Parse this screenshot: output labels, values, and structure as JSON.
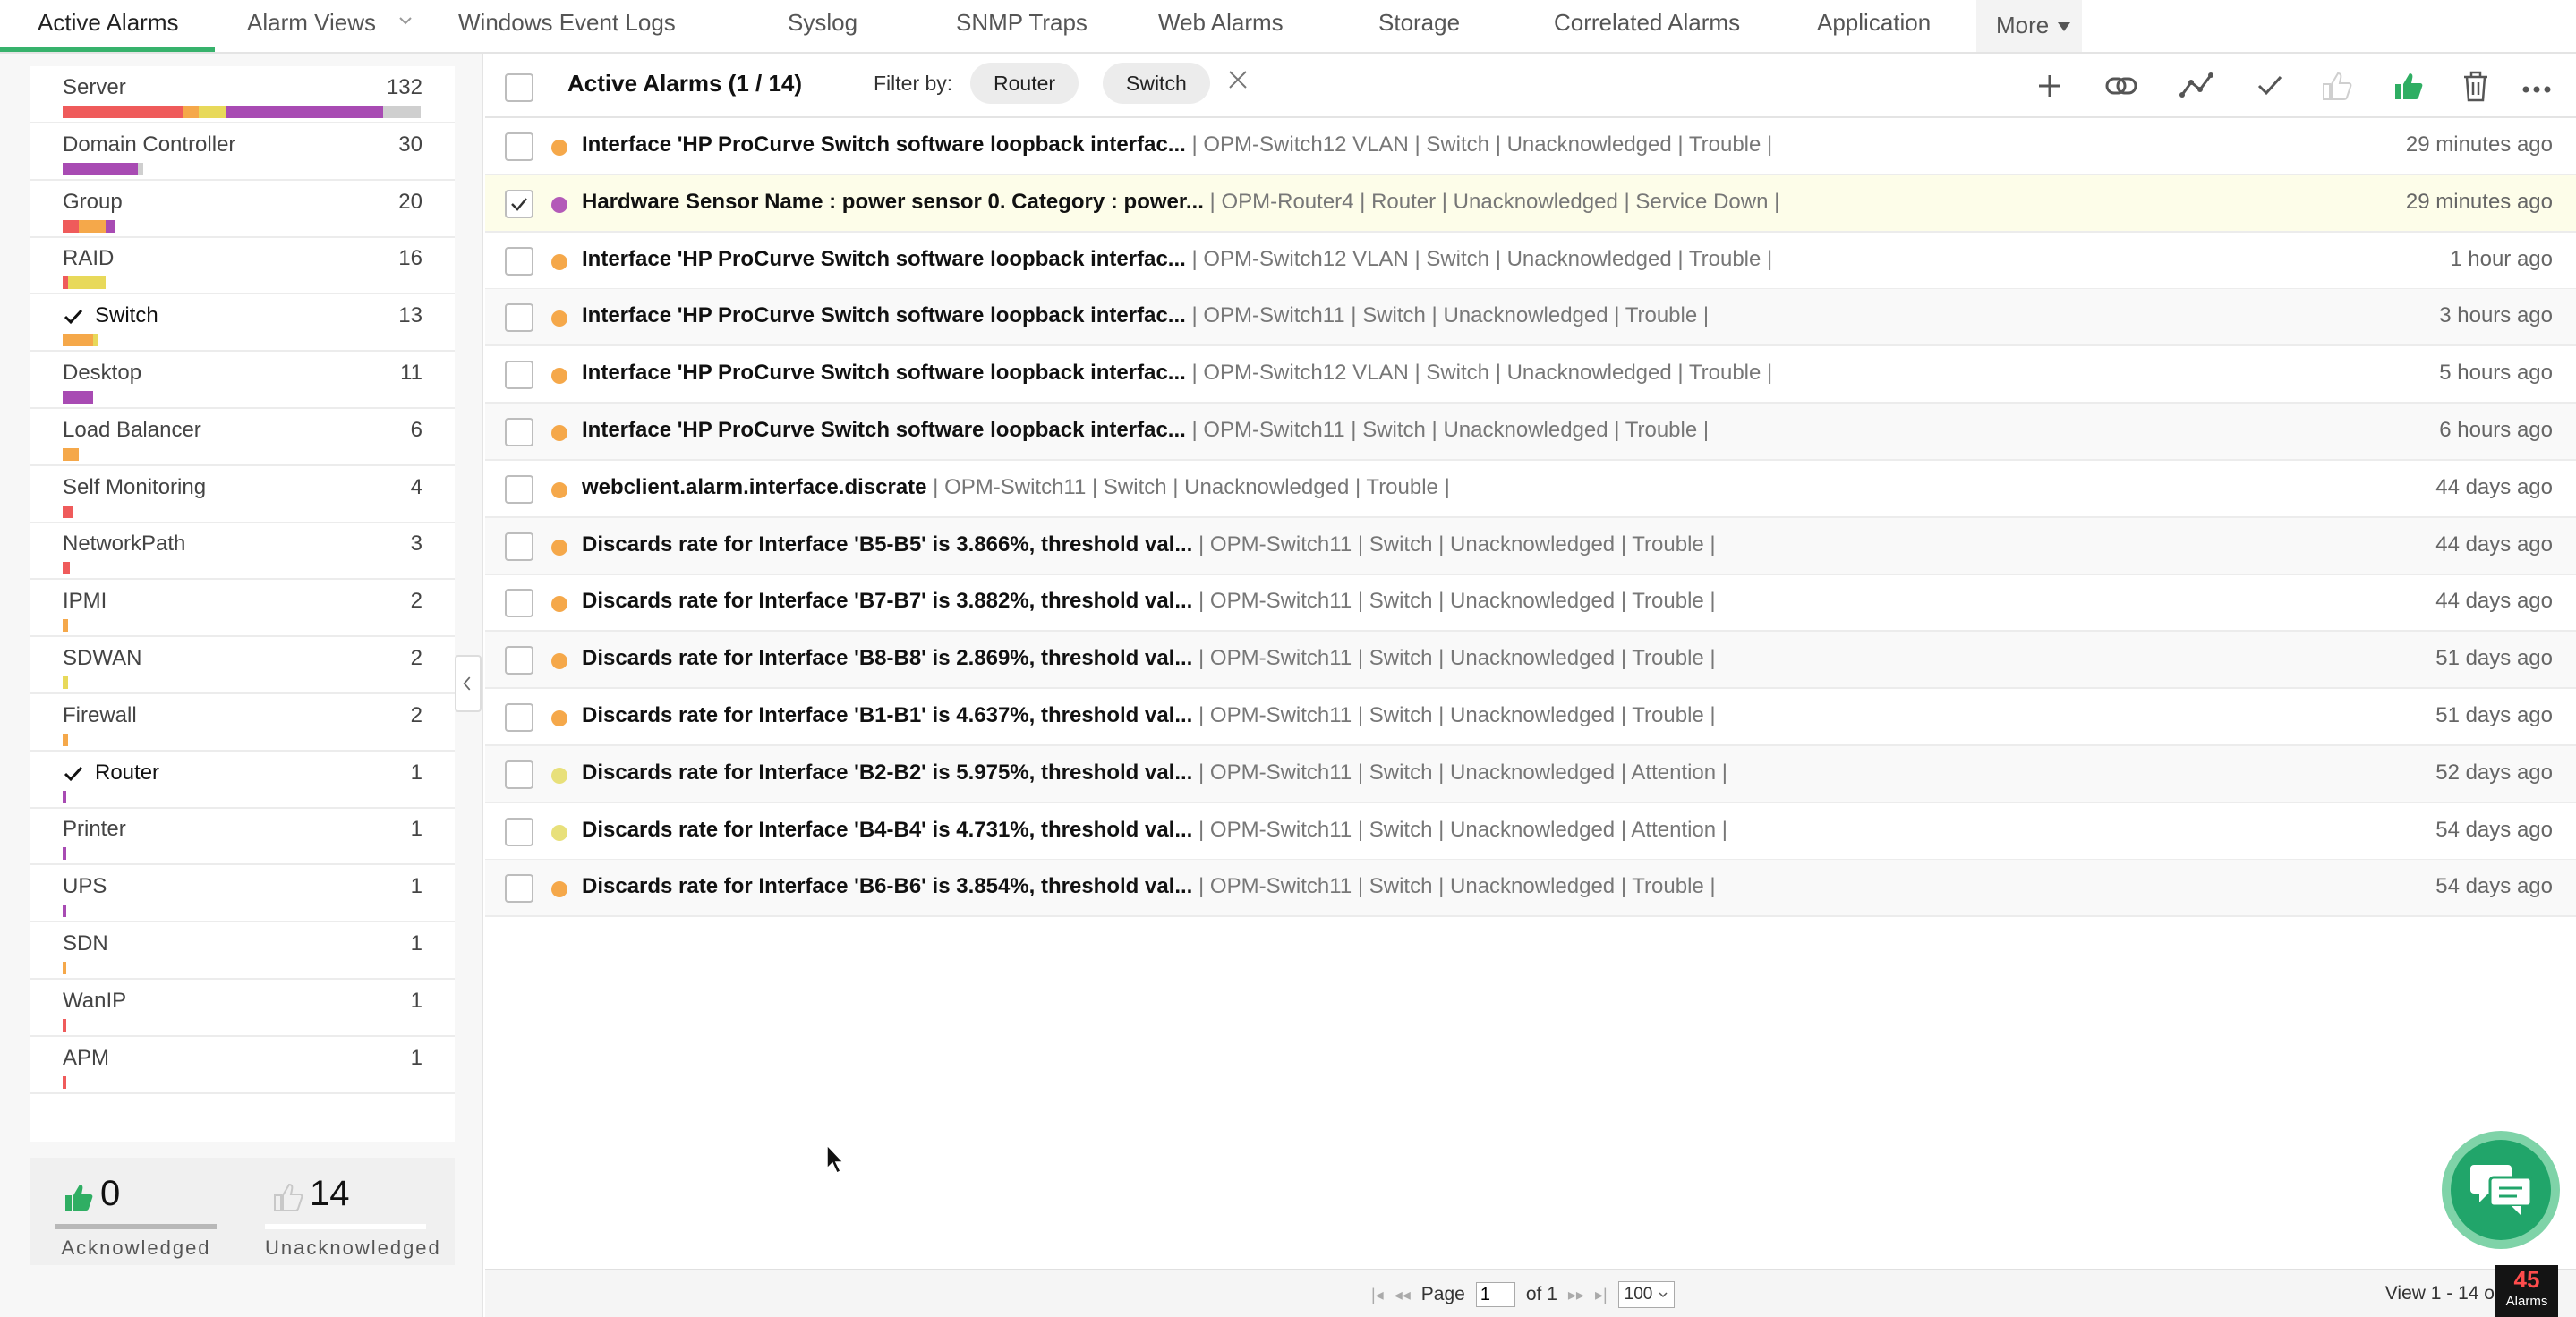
{
  "nav": {
    "tabs": [
      {
        "label": "Active Alarms"
      },
      {
        "label": "Alarm Views"
      },
      {
        "label": "Windows Event Logs"
      },
      {
        "label": "Syslog"
      },
      {
        "label": "SNMP Traps"
      },
      {
        "label": "Web Alarms"
      },
      {
        "label": "Storage"
      },
      {
        "label": "Correlated Alarms"
      },
      {
        "label": "Application"
      }
    ],
    "more_label": "More"
  },
  "categories": [
    {
      "name": "Server",
      "count": "132",
      "checked": false,
      "bar": [
        {
          "c": "#ef5b5b",
          "w": 134
        },
        {
          "c": "#f5a84a",
          "w": 18
        },
        {
          "c": "#e8d95a",
          "w": 30
        },
        {
          "c": "#a84bb3",
          "w": 176
        },
        {
          "c": "#cfcfcf",
          "w": 42
        }
      ]
    },
    {
      "name": "Domain Controller",
      "count": "30",
      "checked": false,
      "bar": [
        {
          "c": "#a84bb3",
          "w": 84
        },
        {
          "c": "#cfcfcf",
          "w": 6
        }
      ]
    },
    {
      "name": "Group",
      "count": "20",
      "checked": false,
      "bar": [
        {
          "c": "#ef5b5b",
          "w": 18
        },
        {
          "c": "#f5a84a",
          "w": 30
        },
        {
          "c": "#a84bb3",
          "w": 10
        }
      ]
    },
    {
      "name": "RAID",
      "count": "16",
      "checked": false,
      "bar": [
        {
          "c": "#ef5b5b",
          "w": 6
        },
        {
          "c": "#e8d95a",
          "w": 42
        }
      ]
    },
    {
      "name": "Switch",
      "count": "13",
      "checked": true,
      "bar": [
        {
          "c": "#f5a84a",
          "w": 34
        },
        {
          "c": "#e8d95a",
          "w": 6
        }
      ]
    },
    {
      "name": "Desktop",
      "count": "11",
      "checked": false,
      "bar": [
        {
          "c": "#a84bb3",
          "w": 34
        }
      ]
    },
    {
      "name": "Load Balancer",
      "count": "6",
      "checked": false,
      "bar": [
        {
          "c": "#f5a84a",
          "w": 18
        }
      ]
    },
    {
      "name": "Self Monitoring",
      "count": "4",
      "checked": false,
      "bar": [
        {
          "c": "#ef5b5b",
          "w": 12
        }
      ]
    },
    {
      "name": "NetworkPath",
      "count": "3",
      "checked": false,
      "bar": [
        {
          "c": "#ef5b5b",
          "w": 8
        }
      ]
    },
    {
      "name": "IPMI",
      "count": "2",
      "checked": false,
      "bar": [
        {
          "c": "#f5a84a",
          "w": 6
        }
      ]
    },
    {
      "name": "SDWAN",
      "count": "2",
      "checked": false,
      "bar": [
        {
          "c": "#e8d95a",
          "w": 6
        }
      ]
    },
    {
      "name": "Firewall",
      "count": "2",
      "checked": false,
      "bar": [
        {
          "c": "#f5a84a",
          "w": 6
        }
      ]
    },
    {
      "name": "Router",
      "count": "1",
      "checked": true,
      "bar": [
        {
          "c": "#a84bb3",
          "w": 4
        }
      ]
    },
    {
      "name": "Printer",
      "count": "1",
      "checked": false,
      "bar": [
        {
          "c": "#a84bb3",
          "w": 4
        }
      ]
    },
    {
      "name": "UPS",
      "count": "1",
      "checked": false,
      "bar": [
        {
          "c": "#a84bb3",
          "w": 4
        }
      ]
    },
    {
      "name": "SDN",
      "count": "1",
      "checked": false,
      "bar": [
        {
          "c": "#f5a84a",
          "w": 4
        }
      ]
    },
    {
      "name": "WanIP",
      "count": "1",
      "checked": false,
      "bar": [
        {
          "c": "#ef5b5b",
          "w": 4
        }
      ]
    },
    {
      "name": "APM",
      "count": "1",
      "checked": false,
      "bar": [
        {
          "c": "#ef5b5b",
          "w": 4
        }
      ]
    }
  ],
  "ack": {
    "acknowledged_count": "0",
    "acknowledged_label": "Acknowledged",
    "unacknowledged_count": "14",
    "unacknowledged_label": "Unacknowledged"
  },
  "header": {
    "title": "Active Alarms (1 / 14)",
    "filter_label": "Filter by:",
    "chips": [
      "Router",
      "Switch"
    ]
  },
  "alarms": [
    {
      "msg": "Interface 'HP ProCurve Switch software loopback interfac...",
      "meta": " | OPM-Switch12 VLAN | Switch | Unacknowledged | Trouble |",
      "time": "29 minutes ago",
      "color": "#f5a84a",
      "selected": false
    },
    {
      "msg": "Hardware Sensor Name : power sensor 0. Category : power...",
      "meta": " | OPM-Router4 | Router | Unacknowledged | Service Down |",
      "time": "29 minutes ago",
      "color": "#b35ab8",
      "selected": true
    },
    {
      "msg": "Interface 'HP ProCurve Switch software loopback interfac...",
      "meta": " | OPM-Switch12 VLAN | Switch | Unacknowledged | Trouble |",
      "time": "1 hour ago",
      "color": "#f5a84a",
      "selected": false
    },
    {
      "msg": "Interface 'HP ProCurve Switch software loopback interfac...",
      "meta": " | OPM-Switch11 | Switch | Unacknowledged | Trouble |",
      "time": "3 hours ago",
      "color": "#f5a84a",
      "selected": false
    },
    {
      "msg": "Interface 'HP ProCurve Switch software loopback interfac...",
      "meta": " | OPM-Switch12 VLAN | Switch | Unacknowledged | Trouble |",
      "time": "5 hours ago",
      "color": "#f5a84a",
      "selected": false
    },
    {
      "msg": "Interface 'HP ProCurve Switch software loopback interfac...",
      "meta": " | OPM-Switch11 | Switch | Unacknowledged | Trouble |",
      "time": "6 hours ago",
      "color": "#f5a84a",
      "selected": false
    },
    {
      "msg": "webclient.alarm.interface.discrate",
      "meta": " | OPM-Switch11 | Switch | Unacknowledged | Trouble |",
      "time": "44 days ago",
      "color": "#f5a84a",
      "selected": false
    },
    {
      "msg": "Discards rate for Interface 'B5-B5' is 3.866%, threshold val...",
      "meta": " | OPM-Switch11 | Switch | Unacknowledged | Trouble |",
      "time": "44 days ago",
      "color": "#f5a84a",
      "selected": false
    },
    {
      "msg": "Discards rate for Interface 'B7-B7' is 3.882%, threshold val...",
      "meta": " | OPM-Switch11 | Switch | Unacknowledged | Trouble |",
      "time": "44 days ago",
      "color": "#f5a84a",
      "selected": false
    },
    {
      "msg": "Discards rate for Interface 'B8-B8' is 2.869%, threshold val...",
      "meta": " | OPM-Switch11 | Switch | Unacknowledged | Trouble |",
      "time": "51 days ago",
      "color": "#f5a84a",
      "selected": false
    },
    {
      "msg": "Discards rate for Interface 'B1-B1' is 4.637%, threshold val...",
      "meta": " | OPM-Switch11 | Switch | Unacknowledged | Trouble |",
      "time": "51 days ago",
      "color": "#f5a84a",
      "selected": false
    },
    {
      "msg": "Discards rate for Interface 'B2-B2' is 5.975%, threshold val...",
      "meta": " | OPM-Switch11 | Switch | Unacknowledged | Attention |",
      "time": "52 days ago",
      "color": "#e8e07a",
      "selected": false
    },
    {
      "msg": "Discards rate for Interface 'B4-B4' is 4.731%, threshold val...",
      "meta": " | OPM-Switch11 | Switch | Unacknowledged | Attention |",
      "time": "54 days ago",
      "color": "#e8e07a",
      "selected": false
    },
    {
      "msg": "Discards rate for Interface 'B6-B6' is 3.854%, threshold val...",
      "meta": " | OPM-Switch11 | Switch | Unacknowledged | Trouble |",
      "time": "54 days ago",
      "color": "#f5a84a",
      "selected": false
    }
  ],
  "footer": {
    "page_label": "Page",
    "page_value": "1",
    "of_label": "of 1",
    "per_page": "100",
    "view_text": "View 1 - 14 of 14"
  },
  "badge": {
    "count": "45",
    "label": "Alarms"
  },
  "colors": {
    "accent": "#37b26c",
    "trouble": "#f5a84a",
    "attention": "#e8e07a",
    "service_down": "#b35ab8",
    "critical": "#ef5b5b"
  }
}
